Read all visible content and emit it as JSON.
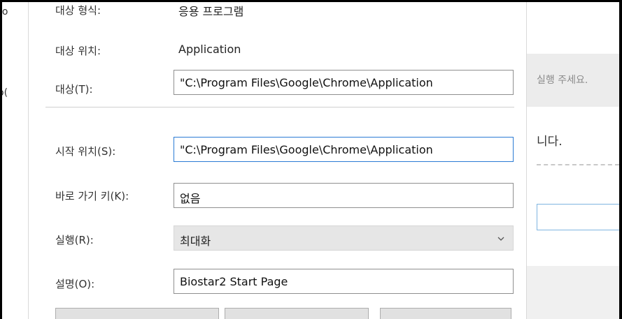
{
  "dialog": {
    "target_type_label": "대상 형식:",
    "target_type_value": "응용 프로그램",
    "target_location_label": "대상 위치:",
    "target_location_value": "Application",
    "target_label": "대상(T):",
    "target_value": "\"C:\\Program Files\\Google\\Chrome\\Application",
    "start_in_label": "시작 위치(S):",
    "start_in_value": "\"C:\\Program Files\\Google\\Chrome\\Application",
    "shortcut_key_label": "바로 가기 키(K):",
    "shortcut_key_value": "없음",
    "run_label": "실행(R):",
    "run_value": "최대화",
    "comment_label": "설명(O):",
    "comment_value": "Biostar2 Start Page"
  },
  "background_window": {
    "left_fragment_top": "lo",
    "left_fragment_mid": "o(",
    "notice_text": "실행 주세요.",
    "message_text": "니다."
  },
  "icons": {
    "dropdown": "chevron-down-icon"
  }
}
